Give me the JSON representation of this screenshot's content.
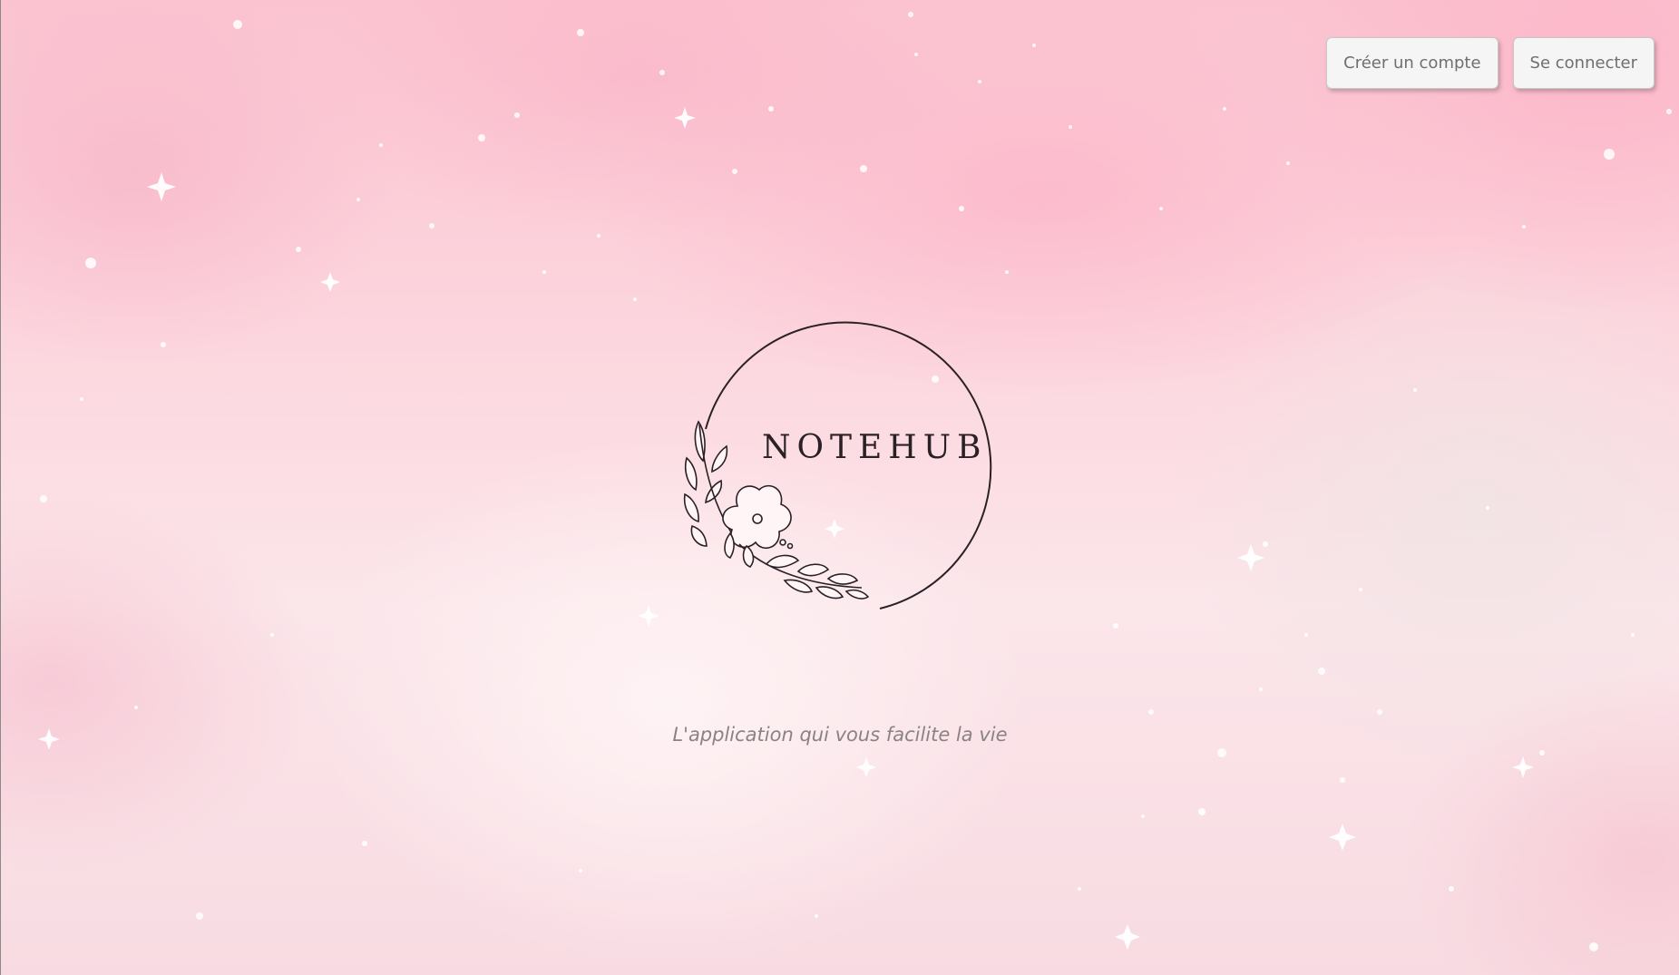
{
  "header": {
    "create_account_label": "Créer un compte",
    "login_label": "Se connecter"
  },
  "logo": {
    "brand_name": "NOTEHUB"
  },
  "hero": {
    "tagline": "L'application qui vous facilite la vie"
  },
  "colors": {
    "background_pink": "#fbc3d0",
    "background_light": "#fbe6ea",
    "button_bg": "#f5f5f5",
    "button_text": "#6f6f6f",
    "logo_ink": "#2a2126",
    "tagline_text": "#8a8284"
  }
}
